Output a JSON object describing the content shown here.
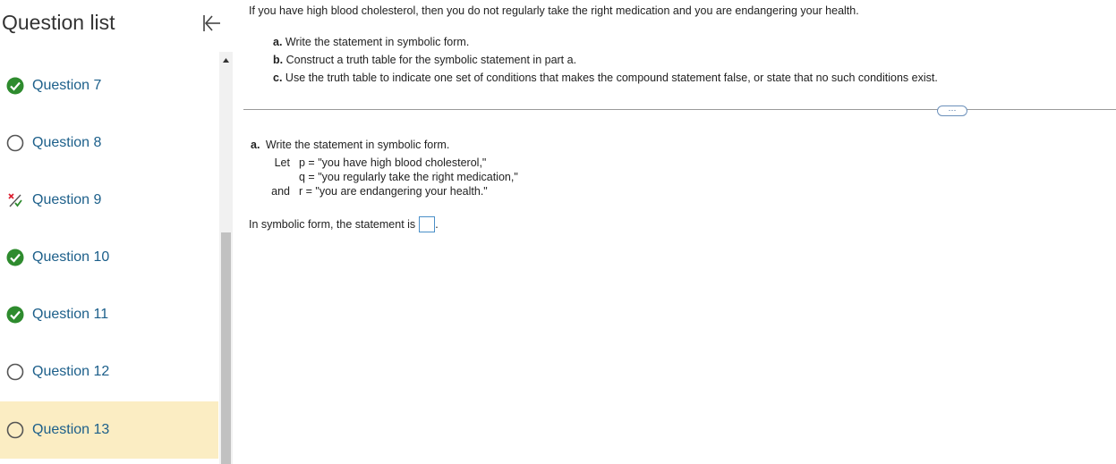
{
  "sidebar": {
    "title": "Question list",
    "items": [
      {
        "label": "Question 7",
        "status": "correct"
      },
      {
        "label": "Question 8",
        "status": "unanswered"
      },
      {
        "label": "Question 9",
        "status": "partial"
      },
      {
        "label": "Question 10",
        "status": "correct"
      },
      {
        "label": "Question 11",
        "status": "correct"
      },
      {
        "label": "Question 12",
        "status": "unanswered"
      },
      {
        "label": "Question 13",
        "status": "unanswered",
        "active": true
      }
    ]
  },
  "question": {
    "intro": "If you have high blood cholesterol, then you do not regularly take the right medication and you are endangering your health.",
    "parts": [
      {
        "letter": "a.",
        "text": "Write the statement in symbolic form."
      },
      {
        "letter": "b.",
        "text": "Construct a truth table for the symbolic statement in part a."
      },
      {
        "letter": "c.",
        "text": "Use the truth table to indicate one set of conditions that makes the compound statement false, or state that no such conditions exist."
      }
    ],
    "more_label": "···"
  },
  "answer": {
    "part_letter": "a.",
    "part_text": "Write the statement in symbolic form.",
    "let_word": "Let",
    "and_word": "and",
    "defs": [
      "p = \"you have high blood cholesterol,\"",
      "q = \"you regularly take the right medication,\"",
      "r = \"you are endangering your health.\""
    ],
    "symbolic_prompt": "In symbolic form, the statement is",
    "symbolic_suffix": ".",
    "symbolic_value": ""
  },
  "colors": {
    "accent": "#1c5f8a",
    "correct": "#2e8b2e",
    "active_bg": "#fbedc3"
  }
}
